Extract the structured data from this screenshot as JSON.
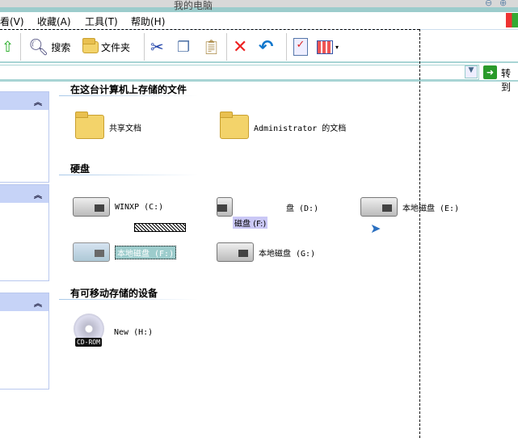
{
  "window": {
    "title": "我的电脑"
  },
  "menu": [
    "看(V)",
    "收藏(A)",
    "工具(T)",
    "帮助(H)"
  ],
  "toolbar": {
    "search": "搜索",
    "folders": "文件夹"
  },
  "address": {
    "go": "转到"
  },
  "sections": [
    {
      "title": "在这台计算机上存储的文件",
      "items": [
        "共享文档",
        "Administrator 的文档"
      ]
    },
    {
      "title": "硬盘",
      "items": [
        "WINXP (C:)",
        "盘 (D:)",
        "本地磁盘 (E:)",
        "磁盘 (F:)",
        "本地磁盘 (F:)",
        "本地磁盘 (G:)"
      ]
    },
    {
      "title": "有可移动存储的设备",
      "items": [
        "New (H:)"
      ]
    }
  ],
  "cdrom_label": "CD-ROM"
}
